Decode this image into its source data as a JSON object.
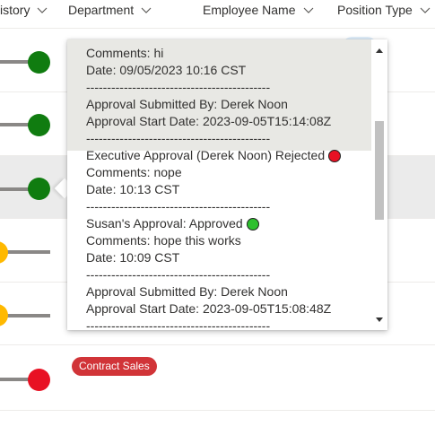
{
  "header": {
    "columns": [
      {
        "label": "istory"
      },
      {
        "label": "Department"
      },
      {
        "label": "Employee Name"
      },
      {
        "label": "Position Type"
      }
    ]
  },
  "rows": [
    {
      "status_color": "green",
      "progress": 1.0
    },
    {
      "status_color": "green",
      "progress": 1.0
    },
    {
      "status_color": "green",
      "progress": 1.0,
      "selected": true
    },
    {
      "status_color": "yellow",
      "progress": 0.05
    },
    {
      "status_color": "yellow",
      "progress": 0.05
    },
    {
      "status_color": "red",
      "progress": 1.0,
      "department_badge": "Contract Sales"
    }
  ],
  "callout": {
    "lines": [
      {
        "text": "Comments: hi"
      },
      {
        "text": "Date: 09/05/2023 10:16 CST"
      },
      {
        "text": "--------------------------------------------"
      },
      {
        "text": "Approval Submitted By: Derek Noon"
      },
      {
        "text": "Approval Start Date: 2023-09-05T15:14:08Z"
      },
      {
        "text": "--------------------------------------------"
      },
      {
        "text": "Executive Approval (Derek Noon) Rejected",
        "status": "red"
      },
      {
        "text": "Comments: nope"
      },
      {
        "text": "Date: 10:13 CST"
      },
      {
        "text": "--------------------------------------------"
      },
      {
        "text": "Susan's Approval: Approved",
        "status": "green"
      },
      {
        "text": "Comments: hope this works"
      },
      {
        "text": "Date: 10:09 CST"
      },
      {
        "text": "--------------------------------------------"
      },
      {
        "text": "Approval Submitted By: Derek Noon"
      },
      {
        "text": "Approval Start Date: 2023-09-05T15:08:48Z"
      },
      {
        "text": "--------------------------------------------"
      }
    ]
  },
  "colors": {
    "green": "#107c10",
    "yellow": "#ffb900",
    "red": "#e81123",
    "badge_red": "#d13438",
    "badge_blue": "#deecf9"
  }
}
